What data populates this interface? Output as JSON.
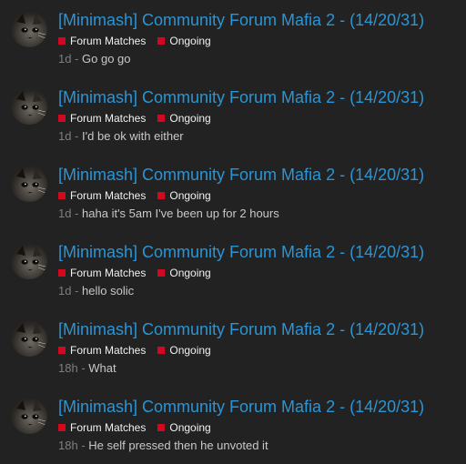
{
  "colors": {
    "background": "#222222",
    "title": "#2a95d6",
    "tag_swatch": "#d0091f",
    "tag_text": "#f0f0f0",
    "age_text": "#7e7e7e",
    "excerpt_text": "#c8c8c8"
  },
  "meta_separator": " - ",
  "posts": [
    {
      "avatar_icon": "user-avatar-cat",
      "title": "[Minimash] Community Forum Mafia 2 - (14/20/31)",
      "tags": [
        {
          "label": "Forum Matches"
        },
        {
          "label": "Ongoing"
        }
      ],
      "age": "1d",
      "excerpt": "Go go go"
    },
    {
      "avatar_icon": "user-avatar-cat",
      "title": "[Minimash] Community Forum Mafia 2 - (14/20/31)",
      "tags": [
        {
          "label": "Forum Matches"
        },
        {
          "label": "Ongoing"
        }
      ],
      "age": "1d",
      "excerpt": "I'd be ok with either"
    },
    {
      "avatar_icon": "user-avatar-cat",
      "title": "[Minimash] Community Forum Mafia 2 - (14/20/31)",
      "tags": [
        {
          "label": "Forum Matches"
        },
        {
          "label": "Ongoing"
        }
      ],
      "age": "1d",
      "excerpt": "haha it's 5am I've been up for 2 hours"
    },
    {
      "avatar_icon": "user-avatar-cat",
      "title": "[Minimash] Community Forum Mafia 2 - (14/20/31)",
      "tags": [
        {
          "label": "Forum Matches"
        },
        {
          "label": "Ongoing"
        }
      ],
      "age": "1d",
      "excerpt": "hello solic"
    },
    {
      "avatar_icon": "user-avatar-cat",
      "title": "[Minimash] Community Forum Mafia 2 - (14/20/31)",
      "tags": [
        {
          "label": "Forum Matches"
        },
        {
          "label": "Ongoing"
        }
      ],
      "age": "18h",
      "excerpt": "What"
    },
    {
      "avatar_icon": "user-avatar-cat",
      "title": "[Minimash] Community Forum Mafia 2 - (14/20/31)",
      "tags": [
        {
          "label": "Forum Matches"
        },
        {
          "label": "Ongoing"
        }
      ],
      "age": "18h",
      "excerpt": "He self pressed then he unvoted it"
    }
  ]
}
